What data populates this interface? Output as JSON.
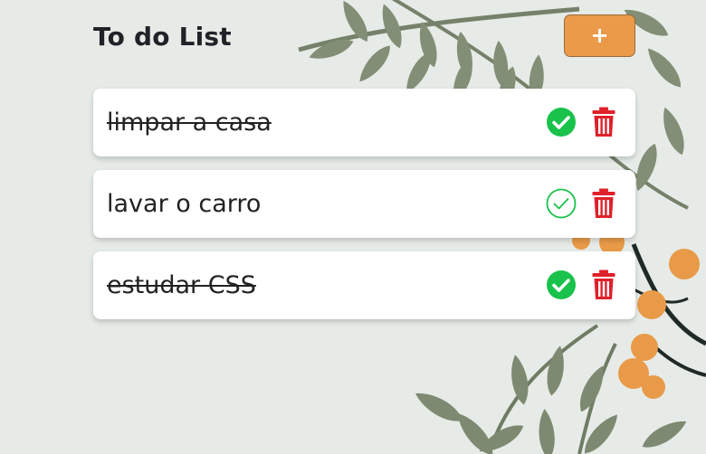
{
  "header": {
    "title": "To do List",
    "add_label": "+"
  },
  "tasks": [
    {
      "text": "limpar a casa",
      "done": true
    },
    {
      "text": "lavar o carro",
      "done": false
    },
    {
      "text": "estudar CSS",
      "done": true
    }
  ],
  "colors": {
    "accent": "#eb9a4a",
    "check": "#19c24a",
    "delete": "#e0202a",
    "leaf": "#7d8a71",
    "berry": "#e89a48"
  }
}
